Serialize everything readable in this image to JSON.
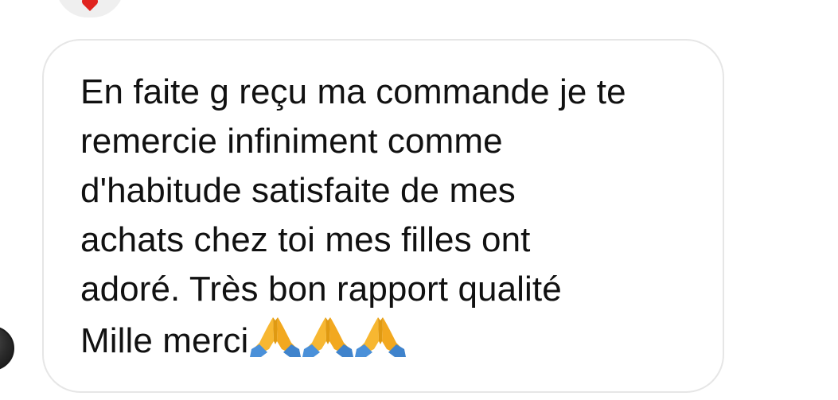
{
  "message": {
    "lines": [
      "En faite g reçu ma commande je te",
      "remercie infiniment comme",
      "d'habitude satisfaite de mes",
      "achats chez toi mes filles ont",
      "adoré. Très bon rapport qualité",
      "Mille merci"
    ],
    "emojis": [
      "🙏",
      "🙏",
      "🙏"
    ]
  },
  "reaction": {
    "icon": "heart-icon",
    "color": "#e0241f"
  },
  "colors": {
    "bubble_border": "#e6e6e6",
    "text": "#111111",
    "reaction_bg": "#efefef"
  }
}
